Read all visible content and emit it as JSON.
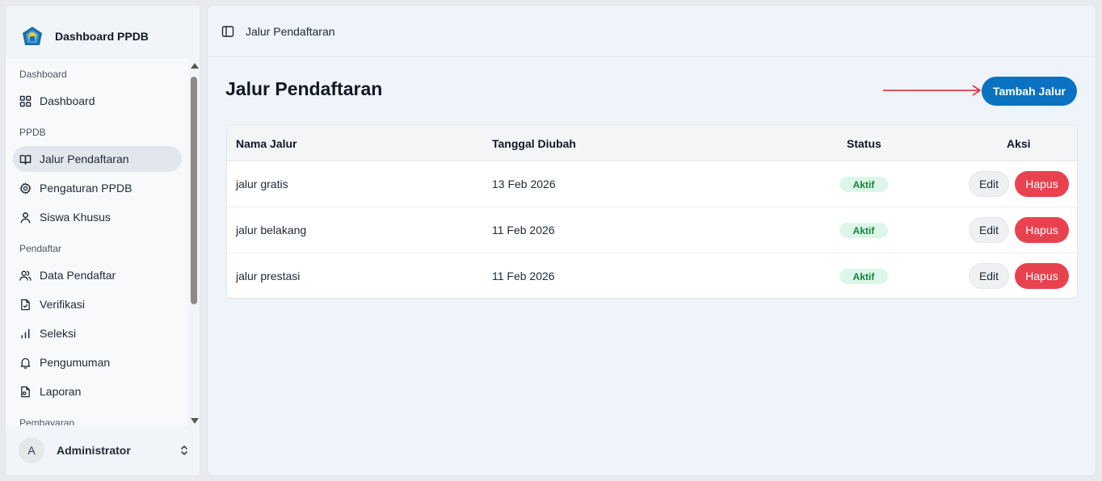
{
  "sidebar": {
    "brand": "Dashboard PPDB",
    "groups": [
      "Dashboard",
      "PPDB",
      "Pendaftar",
      "Pembayaran"
    ],
    "items": [
      {
        "label": "Dashboard",
        "icon": "grid-icon"
      },
      {
        "label": "Jalur Pendaftaran",
        "icon": "book-open-icon",
        "active": true
      },
      {
        "label": "Pengaturan PPDB",
        "icon": "gear-icon"
      },
      {
        "label": "Siswa Khusus",
        "icon": "user-icon"
      },
      {
        "label": "Data Pendaftar",
        "icon": "users-icon"
      },
      {
        "label": "Verifikasi",
        "icon": "file-check-icon"
      },
      {
        "label": "Seleksi",
        "icon": "bar-chart-icon"
      },
      {
        "label": "Pengumuman",
        "icon": "bell-icon"
      },
      {
        "label": "Laporan",
        "icon": "file-report-icon"
      }
    ],
    "user": {
      "initial": "A",
      "name": "Administrator"
    }
  },
  "topbar": {
    "title": "Jalur Pendaftaran"
  },
  "page": {
    "title": "Jalur Pendaftaran",
    "add_label": "Tambah Jalur"
  },
  "table": {
    "headers": [
      "Nama Jalur",
      "Tanggal Diubah",
      "Status",
      "Aksi"
    ],
    "rows": [
      {
        "name": "jalur gratis",
        "date": "13 Feb 2026",
        "status": "Aktif"
      },
      {
        "name": "jalur belakang",
        "date": "11 Feb 2026",
        "status": "Aktif"
      },
      {
        "name": "jalur prestasi",
        "date": "11 Feb 2026",
        "status": "Aktif"
      }
    ],
    "edit_label": "Edit",
    "delete_label": "Hapus"
  },
  "colors": {
    "accent": "#0a72c1",
    "danger": "#e9424f",
    "success_bg": "#dcf7e8",
    "success_text": "#15803d",
    "arrow": "#e11d2a"
  }
}
